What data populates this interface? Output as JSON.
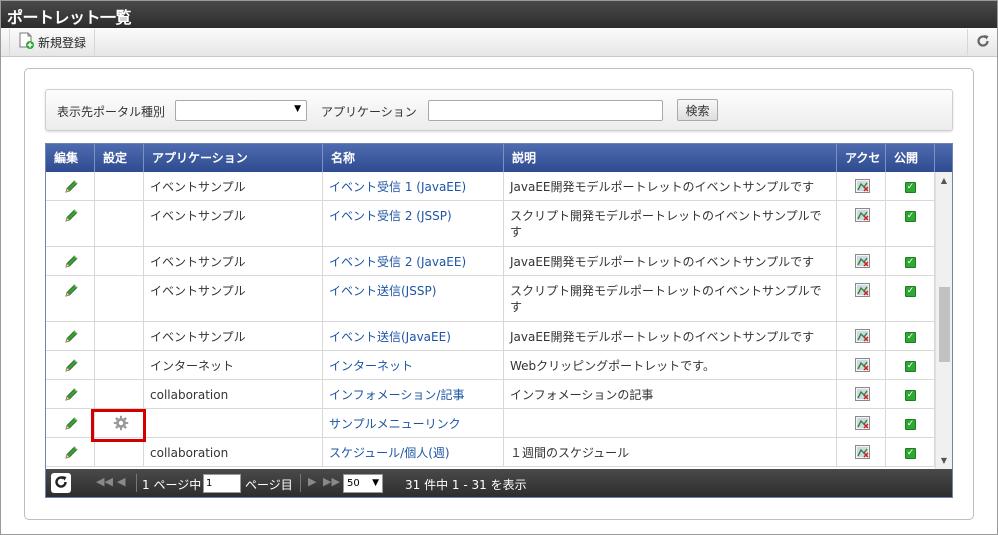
{
  "title": "ポートレット一覧",
  "toolbar": {
    "new_label": "新規登録"
  },
  "search": {
    "portal_type_label": "表示先ポータル種別",
    "portal_type_value": "",
    "application_label": "アプリケーション",
    "application_value": "",
    "button_label": "検索"
  },
  "grid": {
    "headers": [
      "編集",
      "設定",
      "アプリケーション",
      "名称",
      "説明",
      "アクセ",
      "公開"
    ],
    "rows": [
      {
        "app": "イベントサンプル",
        "name": "イベント受信 1 (JavaEE)",
        "desc": "JavaEE開発モデルポートレットのイベントサンプルです"
      },
      {
        "app": "イベントサンプル",
        "name": "イベント受信 2 (JSSP)",
        "desc": "スクリプト開発モデルポートレットのイベントサンプルです"
      },
      {
        "app": "イベントサンプル",
        "name": "イベント受信 2 (JavaEE)",
        "desc": "JavaEE開発モデルポートレットのイベントサンプルです"
      },
      {
        "app": "イベントサンプル",
        "name": "イベント送信(JSSP)",
        "desc": "スクリプト開発モデルポートレットのイベントサンプルです"
      },
      {
        "app": "イベントサンプル",
        "name": "イベント送信(JavaEE)",
        "desc": "JavaEE開発モデルポートレットのイベントサンプルです"
      },
      {
        "app": "インターネット",
        "name": "インターネット",
        "desc": "Webクリッピングポートレットです。"
      },
      {
        "app": "collaboration",
        "name": "インフォメーション/記事",
        "desc": "インフォメーションの記事"
      },
      {
        "app": "",
        "name": "サンプルメニューリンク",
        "desc": "",
        "has_settings": true
      },
      {
        "app": "collaboration",
        "name": "スケジュール/個人(週)",
        "desc": "１週間のスケジュール"
      }
    ]
  },
  "pager": {
    "page_prefix": "1 ページ中",
    "page_value": "1",
    "page_suffix": "ページ目",
    "per_page": "50",
    "summary": "31 件中 1 - 31 を表示"
  },
  "colors": {
    "header_blue": "#3b58a0",
    "link": "#1d55a5",
    "title_bar": "#333333",
    "highlight": "#d40000"
  }
}
